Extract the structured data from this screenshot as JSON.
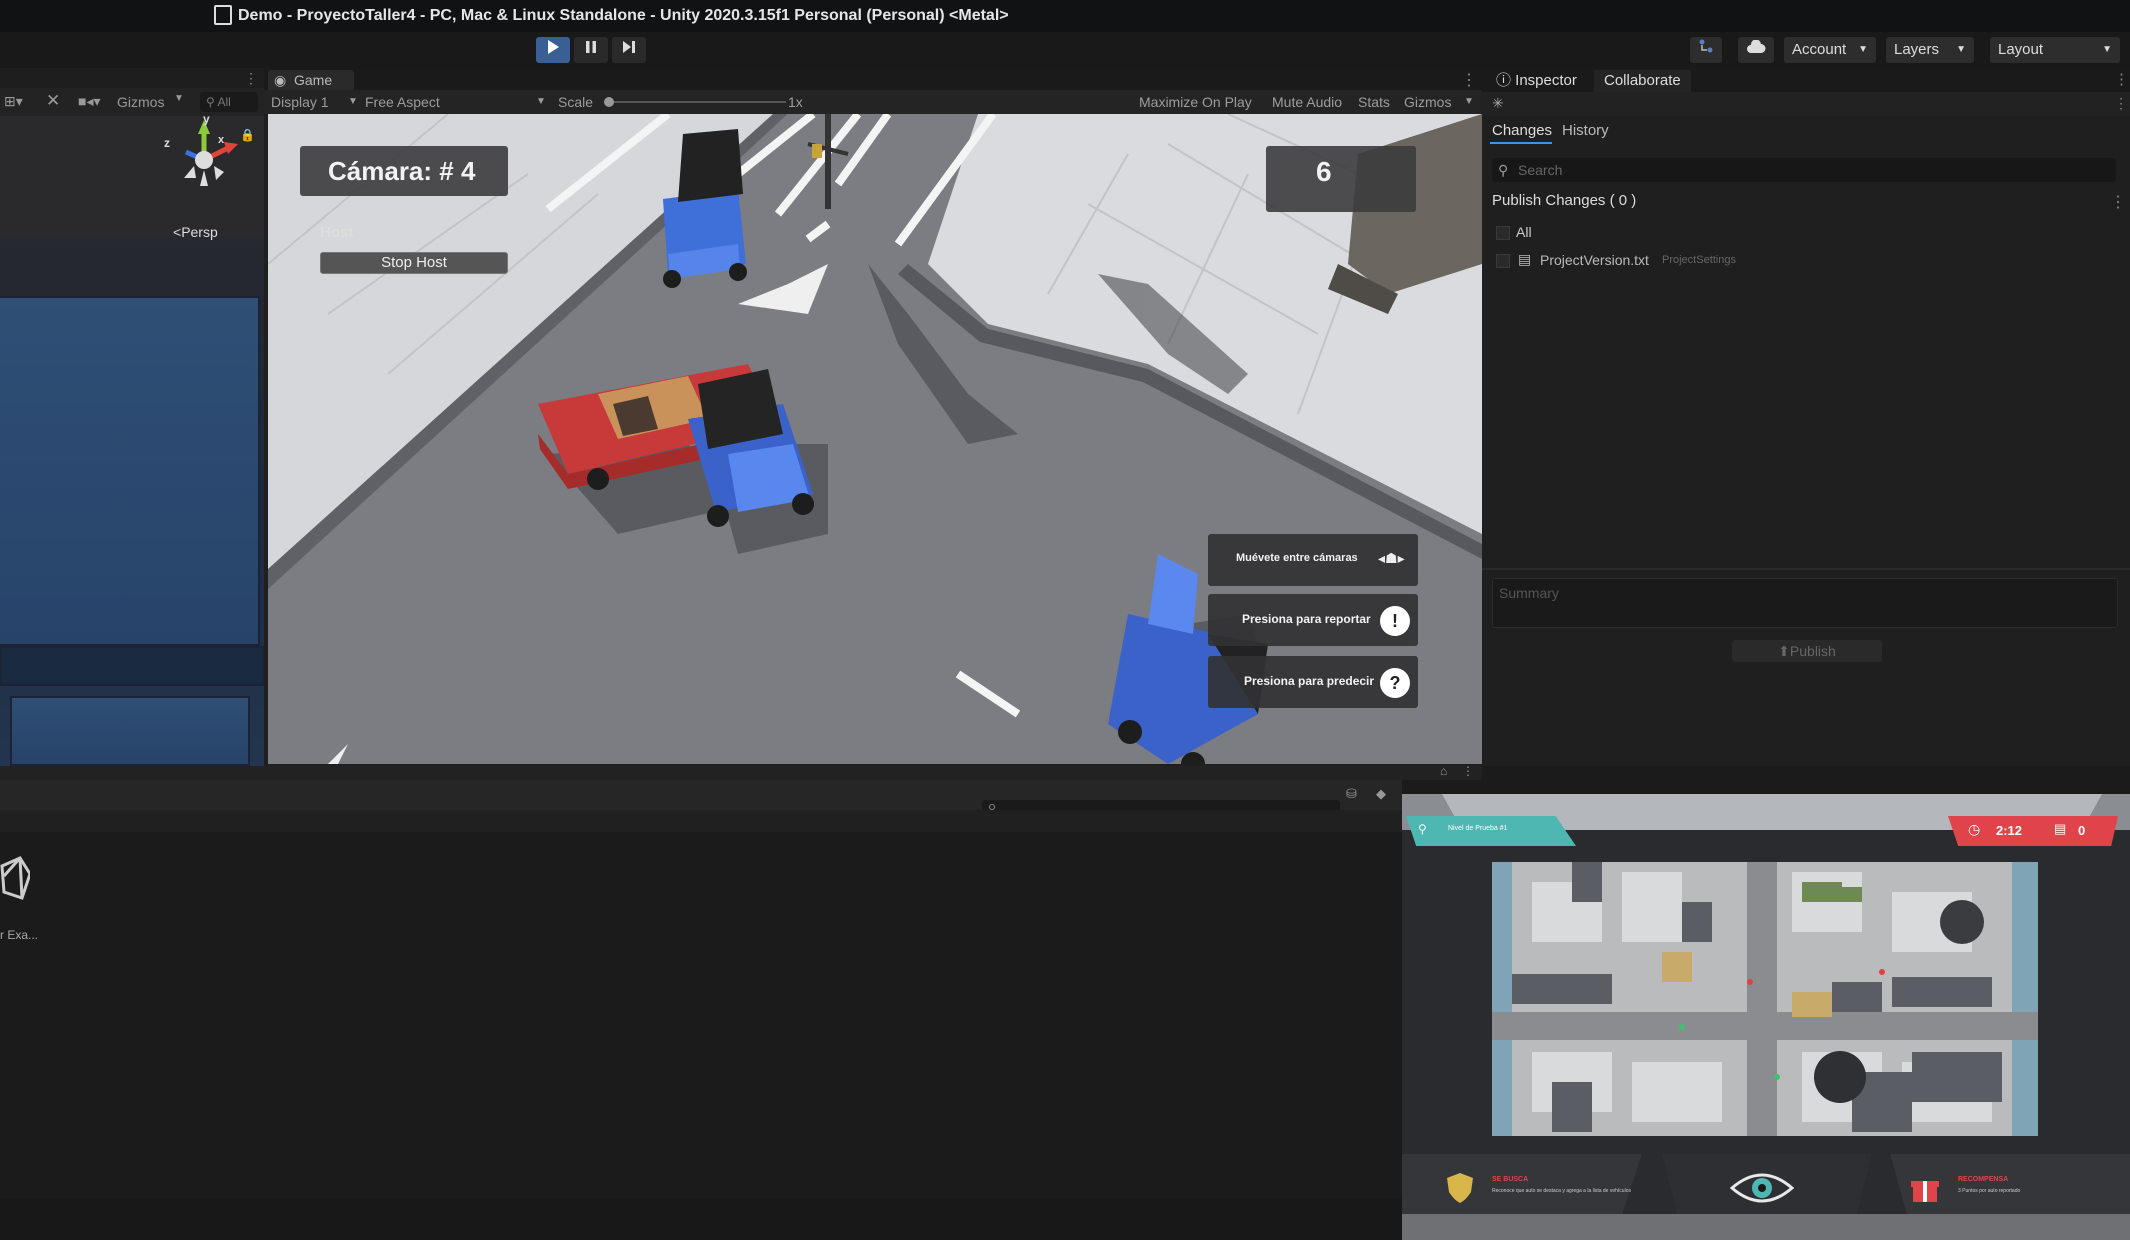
{
  "window": {
    "title": "Demo - ProyectoTaller4 - PC, Mac & Linux Standalone - Unity 2020.3.15f1 Personal (Personal) <Metal>"
  },
  "toolbar": {
    "account": "Account",
    "layers": "Layers",
    "layout": "Layout"
  },
  "scene": {
    "gizmos": "Gizmos",
    "search": "All",
    "persp": "Persp",
    "axis_y": "y",
    "axis_x": "x",
    "axis_z": "z"
  },
  "game": {
    "tab": "Game",
    "display": "Display 1",
    "aspect": "Free Aspect",
    "scale_label": "Scale",
    "scale_value": "1x",
    "maximize": "Maximize On Play",
    "mute": "Mute Audio",
    "stats": "Stats",
    "gizmos": "Gizmos"
  },
  "hud": {
    "camera_label": "Cámara: # 4",
    "host_label": "Host",
    "stop_host": "Stop Host",
    "counter": "6",
    "hint_move": "Muévete entre cámaras",
    "hint_report": "Presiona para reportar",
    "hint_predict": "Presiona para predecir",
    "report_icon": "!",
    "predict_icon": "?"
  },
  "inspector": {
    "tab_inspector": "Inspector",
    "tab_collaborate": "Collaborate",
    "tab_changes": "Changes",
    "tab_history": "History",
    "search_placeholder": "Search",
    "publish_changes": "Publish Changes ( 0 )",
    "all_label": "All",
    "file_name": "ProjectVersion.txt",
    "file_dir": "ProjectSettings",
    "summary_placeholder": "Summary",
    "publish_button": "Publish"
  },
  "project": {
    "asset_label": "r Exa..."
  },
  "overlay": {
    "level_label": "Nivel de Prueba #1",
    "timer": "2:12",
    "count": "0",
    "wanted_title": "SE BUSCA",
    "wanted_text": "Reconoce que auto se destaca y agrega a la lista de vehículos",
    "reward_title": "RECOMPENSA",
    "reward_text": "3 Puntos por auto reportado"
  },
  "colors": {
    "play_active": "#3a5f95",
    "hud_teal": "#4fb7b2",
    "hud_red": "#e0434a",
    "accent_blue": "#4a8fe0"
  }
}
